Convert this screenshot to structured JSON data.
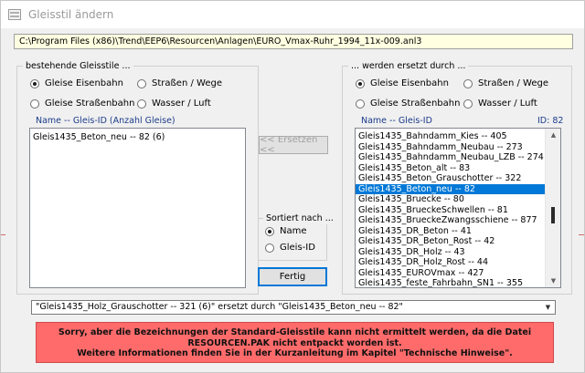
{
  "window": {
    "title": "Gleisstil ändern"
  },
  "path": "C:\\Program Files (x86)\\Trend\\EEP6\\Resourcen\\Anlagen\\EURO_Vmax-Ruhr_1994_11x-009.anl3",
  "left_group": {
    "title": "bestehende Gleisstile ...",
    "radios": [
      {
        "label": "Gleise Eisenbahn",
        "checked": true
      },
      {
        "label": "Straßen / Wege",
        "checked": false
      },
      {
        "label": "Gleise Straßenbahn",
        "checked": false
      },
      {
        "label": "Wasser / Luft",
        "checked": false
      }
    ],
    "column_header": "Name -- Gleis-ID (Anzahl Gleise)",
    "items": [
      "Gleis1435_Beton_neu -- 82 (6)"
    ]
  },
  "right_group": {
    "title": "... werden ersetzt durch ...",
    "radios": [
      {
        "label": "Gleise Eisenbahn",
        "checked": true
      },
      {
        "label": "Straßen / Wege",
        "checked": false
      },
      {
        "label": "Gleise Straßenbahn",
        "checked": false
      },
      {
        "label": "Wasser / Luft",
        "checked": false
      }
    ],
    "column_header": "Name -- Gleis-ID",
    "id_label": "ID: 82",
    "items": [
      "Gleis1435_Bahndamm_Kies -- 405",
      "Gleis1435_Bahndamm_Neubau -- 273",
      "Gleis1435_Bahndamm_Neubau_LZB -- 274",
      "Gleis1435_Beton_alt -- 83",
      "Gleis1435_Beton_Grauschotter -- 322",
      "Gleis1435_Beton_neu -- 82",
      "Gleis1435_Bruecke -- 80",
      "Gleis1435_BrueckeSchwellen -- 81",
      "Gleis1435_BrueckeZwangsschiene -- 877",
      "Gleis1435_DR_Beton -- 41",
      "Gleis1435_DR_Beton_Rost -- 42",
      "Gleis1435_DR_Holz -- 43",
      "Gleis1435_DR_Holz_Rost -- 44",
      "Gleis1435_EUROVmax -- 427",
      "Gleis1435_feste_Fahrbahn_SN1 -- 355"
    ],
    "selected_index": 5
  },
  "buttons": {
    "replace": "<< Ersetzen <<",
    "done": "Fertig"
  },
  "sort_group": {
    "title": "Sortiert nach ...",
    "radios": [
      {
        "label": "Name",
        "checked": true
      },
      {
        "label": "Gleis-ID",
        "checked": false
      }
    ]
  },
  "combo_value": "\"Gleis1435_Holz_Grauschotter -- 321 (6)\" ersetzt durch \"Gleis1435_Beton_neu -- 82\"",
  "warning": {
    "line1": "Sorry, aber die Bezeichnungen der Standard-Gleisstile kann nicht ermittelt werden, da die Datei",
    "line2": "RESOURCEN.PAK nicht entpackt worden ist.",
    "line3": "Weitere Informationen finden Sie in der Kurzanleitung im Kapitel \"Technische Hinweise\"."
  },
  "colors": {
    "accent": "#0078d7",
    "warning_bg": "#ff6b6b",
    "path_bg": "#ffffe1"
  }
}
